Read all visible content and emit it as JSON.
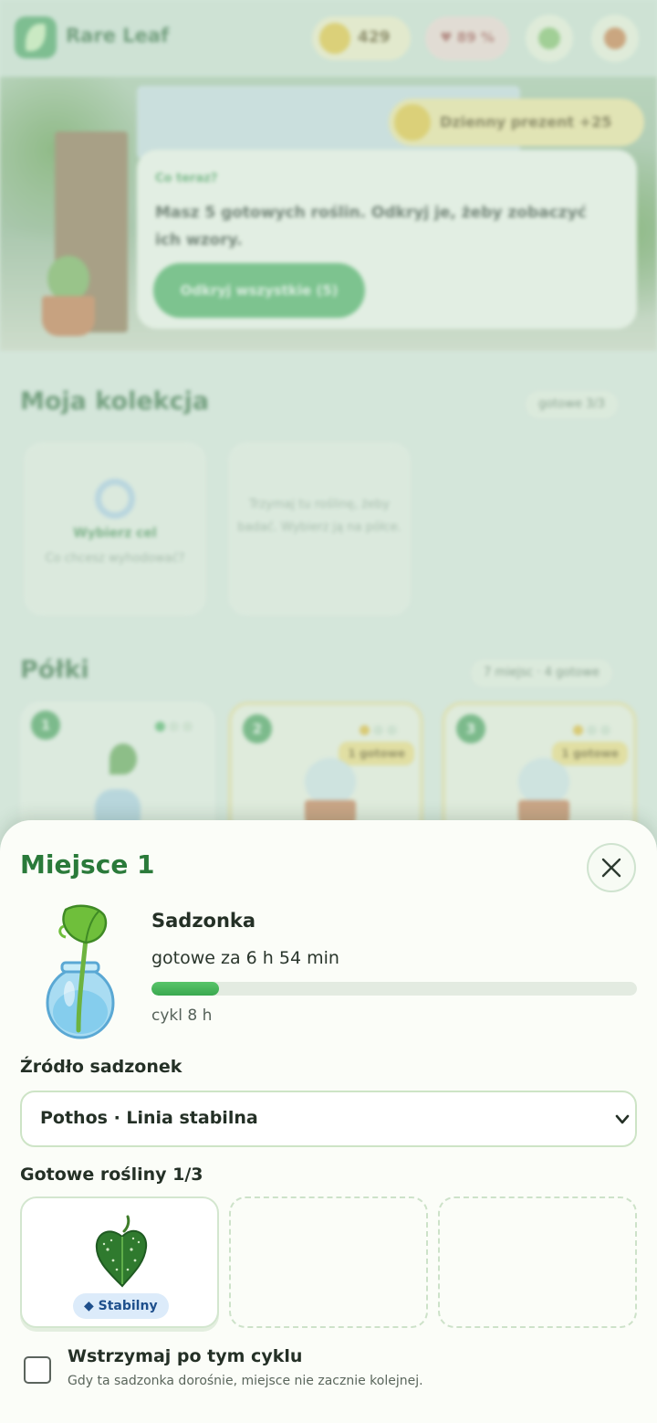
{
  "app": {
    "title": "Rare Leaf",
    "coins": "429",
    "health": "♥ 89 %"
  },
  "hero": {
    "bonus": "Dzienny prezent +25",
    "tip_kicker": "Co teraz?",
    "tip_text": "Masz 5 gotowych roślin. Odkryj je, żeby zobaczyć ich wzory.",
    "tip_button": "Odkryj wszystkie (5)"
  },
  "collection": {
    "title": "Moja kolekcja",
    "counter": "gotowe 3/3",
    "card1_title": "Wybierz cel",
    "card1_sub": "Co chcesz wyhodować?",
    "card2_text": "Trzymaj tu roślinę, żeby badać. Wybierz ją na półce."
  },
  "shelves": {
    "title": "Półki",
    "counter": "7 miejsc · 4 gotowe",
    "cards": [
      {
        "num": "1",
        "badge": ""
      },
      {
        "num": "2",
        "badge": "1 gotowe"
      },
      {
        "num": "3",
        "badge": "1 gotowe"
      }
    ]
  },
  "sheet": {
    "title": "Miejsce 1",
    "stage": "Sadzonka",
    "ready_in": "gotowe za 6 h 54 min",
    "progress_percent": 14,
    "cycle": "cykl 8 h",
    "source_label": "Źródło sadzonek",
    "source_value": "Pothos · Linia stabilna",
    "ready_label": "Gotowe rośliny 1/3",
    "slots": [
      {
        "filled": true,
        "badge": "◆ Stabilny"
      },
      {
        "filled": false
      },
      {
        "filled": false
      }
    ],
    "pause_title": "Wstrzymaj po tym cyklu",
    "pause_sub": "Gdy ta sadzonka dorośnie, miejsce nie zacznie kolejnej.",
    "pause_checked": false
  },
  "colors": {
    "brand_green": "#2a7a3a",
    "progress": "#3aa84f",
    "badge_blue": "#1e4f8c"
  }
}
